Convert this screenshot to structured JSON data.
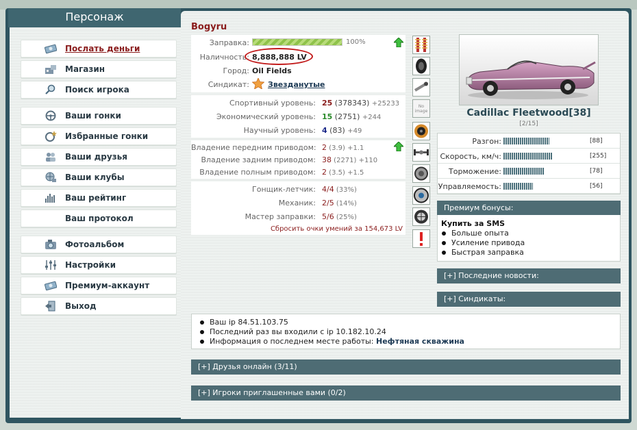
{
  "left_tab": {
    "title": "Персонаж"
  },
  "menu": [
    {
      "label": "Послать деньги",
      "icon": "money-icon",
      "active": true
    },
    {
      "label": "Магазин",
      "icon": "shop-icon"
    },
    {
      "label": "Поиск игрока",
      "icon": "search-icon"
    },
    {
      "label": "Ваши гонки",
      "icon": "steering-wheel-icon"
    },
    {
      "label": "Избранные гонки",
      "icon": "favorite-races-icon"
    },
    {
      "label": "Ваши друзья",
      "icon": "friends-icon"
    },
    {
      "label": "Ваши клубы",
      "icon": "clubs-icon"
    },
    {
      "label": "Ваш рейтинг",
      "icon": "rating-icon"
    },
    {
      "label": "Ваш протокол",
      "icon": ""
    },
    {
      "label": "Фотоальбом",
      "icon": "camera-icon"
    },
    {
      "label": "Настройки",
      "icon": "settings-sliders-icon"
    },
    {
      "label": "Премиум-аккаунт",
      "icon": "premium-icon"
    },
    {
      "label": "Выход",
      "icon": "exit-icon"
    }
  ],
  "player": {
    "name": "Bogyru",
    "fuel_label": "Заправка:",
    "fuel_percent": "100%",
    "fuel_level": 1.0,
    "cash_label": "Наличность:",
    "cash_value": "8,888,888 LV",
    "city_label": "Город:",
    "city_value": "Oil Fields",
    "syndicate_label": "Синдикат:",
    "syndicate_value": "Звезданутые"
  },
  "levels": [
    {
      "label": "Спортивный уровень:",
      "value": "25",
      "sub": "(378343)",
      "bonus": "+25233",
      "color": "red"
    },
    {
      "label": "Экономический уровень:",
      "value": "15",
      "sub": "(2751)",
      "bonus": "+244",
      "color": "green"
    },
    {
      "label": "Научный уровень:",
      "value": "4",
      "sub": "(83)",
      "bonus": "+49",
      "color": "blue"
    }
  ],
  "drives": [
    {
      "label": "Владение передним приводом:",
      "value": "2",
      "sub": "(3.9)",
      "bonus": "+1.1"
    },
    {
      "label": "Владение задним приводом:",
      "value": "38",
      "sub": "(2271)",
      "bonus": "+110"
    },
    {
      "label": "Владение полным приводом:",
      "value": "2",
      "sub": "(3.5)",
      "bonus": "+1.5"
    }
  ],
  "skills": [
    {
      "label": "Гонщик-летчик:",
      "value": "4/4",
      "pct": "(33%)"
    },
    {
      "label": "Механик:",
      "value": "2/5",
      "pct": "(14%)"
    },
    {
      "label": "Мастер заправки:",
      "value": "5/6",
      "pct": "(25%)"
    }
  ],
  "reset_skills": "Сбросить очки умений за 154,673 LV",
  "upgrade_icons": [
    "suspension-icon",
    "tire-icon",
    "exhaust-icon",
    "no-image-icon",
    "clutch-icon",
    "axle-icon",
    "turbo-icon",
    "brakes-icon",
    "wheel-rim-icon",
    "warning-icon"
  ],
  "no_image_text": "No image",
  "car": {
    "name": "Cadillac Fleetwood[38]",
    "sub": "[2/15]",
    "specs": [
      {
        "label": "Разгон:",
        "value": "[88]",
        "level": 0.55
      },
      {
        "label": "Скорость, км/ч:",
        "value": "[255]",
        "level": 0.58
      },
      {
        "label": "Торможение:",
        "value": "[78]",
        "level": 0.49
      },
      {
        "label": "Управляемость:",
        "value": "[56]",
        "level": 0.35
      }
    ]
  },
  "premium": {
    "header": "Премиум бонусы:",
    "title": "Купить за SMS",
    "items": [
      "Больше опыта",
      "Усиление привода",
      "Быстрая заправка"
    ]
  },
  "news_bar": "[+]   Последние новости:",
  "syndicates_bar": "[+]   Синдикаты:",
  "info": [
    {
      "text": "Ваш ip 84.51.103.75",
      "strong": ""
    },
    {
      "text": "Последний раз вы входили с ip 10.182.10.24",
      "strong": ""
    },
    {
      "text": "Информация о последнем месте работы: ",
      "strong": "Нефтяная скважина"
    }
  ],
  "friends_online_bar": "[+]   Друзья онлайн (3/11)",
  "invited_bar": "[+]   Игроки приглашенные вами (0/2)",
  "colors": {
    "accent_red": "#8a1c1c",
    "panel_dark": "#2f5560",
    "section_bar": "#4e6c74"
  }
}
